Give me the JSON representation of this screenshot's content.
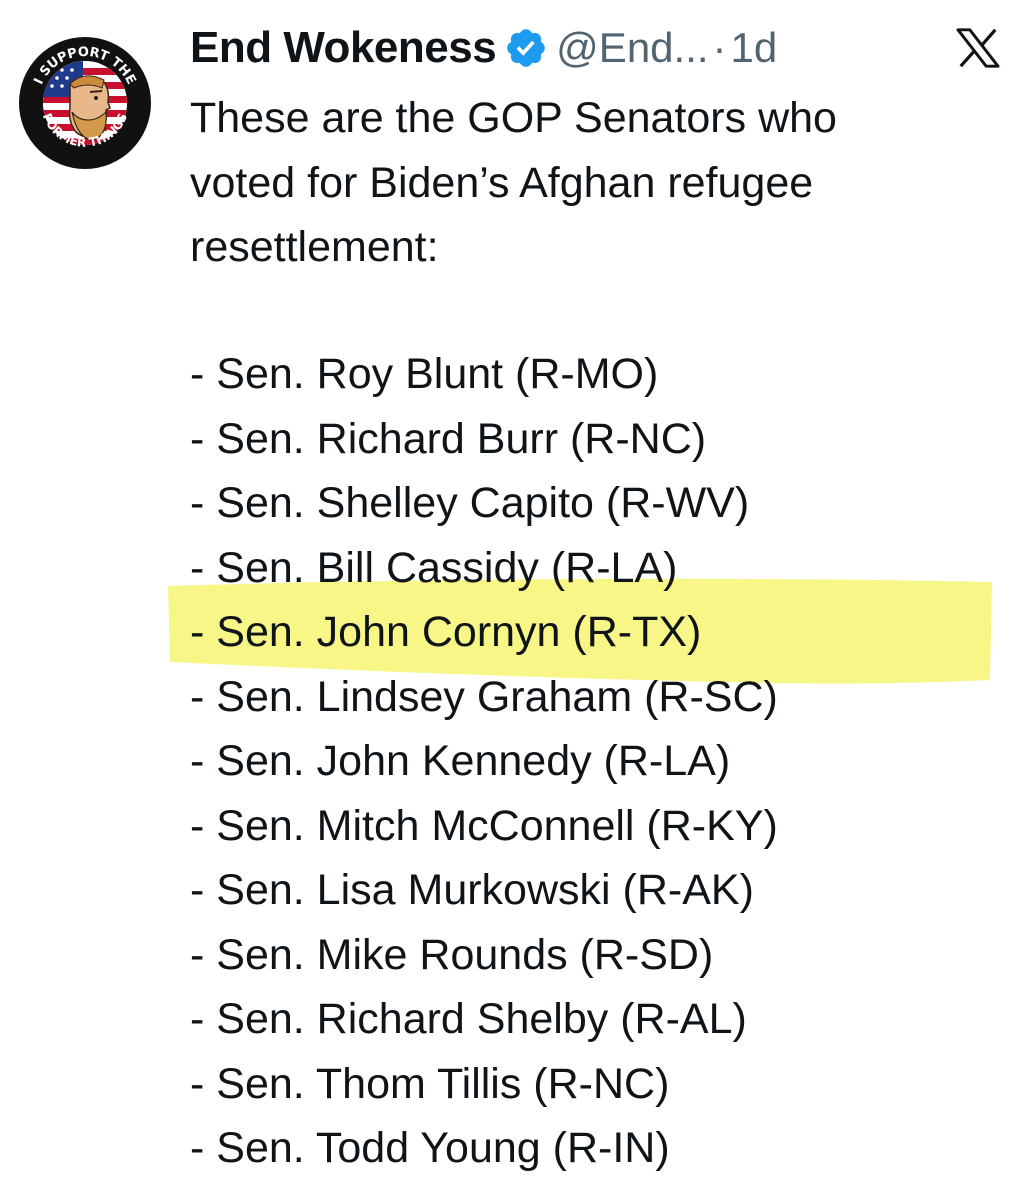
{
  "post": {
    "author": {
      "display_name": "End Wokeness",
      "handle": "@End...",
      "separator": "·",
      "timestamp": "1d",
      "avatar_texts": [
        "I SUPPORT THE",
        "FORMER THINGS"
      ]
    },
    "platform_logo": "x-logo-icon",
    "verified_icon": "verified-badge-icon",
    "text": "These are the GOP Senators who\nvoted for Biden’s Afghan refugee\nresettlement:",
    "senators": [
      "- Sen. Roy Blunt (R-MO)",
      "- Sen. Richard Burr (R-NC)",
      "- Sen. Shelley Capito (R-WV)",
      "- Sen. Bill Cassidy (R-LA)",
      "- Sen. John Cornyn (R-TX)",
      "- Sen. Lindsey Graham (R-SC)",
      "- Sen. John Kennedy (R-LA)",
      "- Sen. Mitch McConnell (R-KY)",
      "- Sen. Lisa Murkowski (R-AK)",
      "- Sen. Mike Rounds (R-SD)",
      "- Sen. Richard Shelby (R-AL)",
      "- Sen. Thom Tillis (R-NC)",
      "- Sen. Todd Young (R-IN)"
    ],
    "highlighted_senator": "- Sen. John Cornyn (R-TX)"
  },
  "colors": {
    "text": "#0f1419",
    "secondary_text": "#536471",
    "verified": "#1d9bf0",
    "highlight": "#f6f572"
  }
}
